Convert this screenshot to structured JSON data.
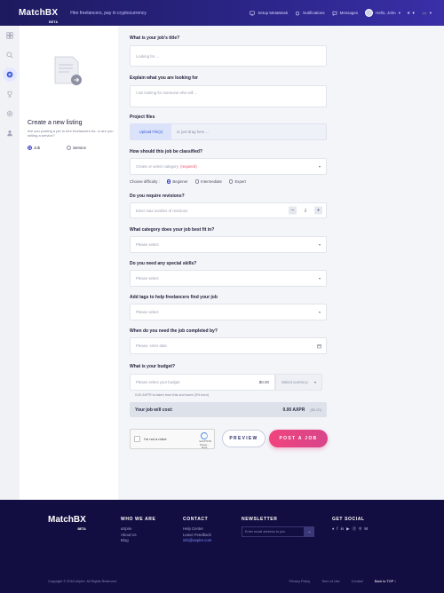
{
  "header": {
    "logo": "MatchBX",
    "logo_badge": "BETA",
    "tagline": "Hire freelancers, pay in cryptocurrency",
    "nav": [
      "Setup MetaMask",
      "Notifications",
      "Messages"
    ],
    "user_greeting": "Hello, John",
    "currency_short": "€"
  },
  "side": {
    "title": "Create a new listing",
    "description": "Are you posting a job to hire freelancers for, or are you selling a service?",
    "options": [
      "Job",
      "Service"
    ],
    "selected": "Job"
  },
  "form": {
    "title_q": "What is your job's title?",
    "title_placeholder": "Looking for ...",
    "explain_q": "Explain what you are looking for",
    "explain_placeholder": "I am looking for someone who will ...",
    "files_q": "Project files",
    "upload_btn": "Upload File(s)",
    "upload_hint": "or just drag here ...",
    "classify_q": "How should this job be classified?",
    "classify_placeholder": "Create or select category",
    "classify_required": "(required)",
    "difficulty_label": "Choose difficulty :",
    "difficulty_options": [
      "Beginner",
      "Intermediate",
      "Expert"
    ],
    "difficulty_selected": "Beginner",
    "revisions_q": "Do you require revisions?",
    "revisions_placeholder": "Enter max number of revisions",
    "revisions_value": "2",
    "revisions_minus": "−",
    "revisions_plus": "+",
    "category_q": "What category does your job best fit in?",
    "category_placeholder": "Please select",
    "skills_q": "Do you need any special skills?",
    "skills_placeholder": "Please select",
    "tags_q": "Add tags to help freelancers find your job",
    "tags_placeholder": "Please select",
    "date_q": "When do you need the job completed by?",
    "date_placeholder": "Please, enter date",
    "budget_q": "What is your budget?",
    "budget_placeholder": "Please select your budget",
    "budget_usd": "$0.00",
    "currency_placeholder": "Select currency",
    "burn_note": "0.00 AXPR is taken from this and burnt (3% burn)",
    "cost_label": "Your job will cost:",
    "cost_amount": "0.00 AXPR",
    "cost_usd": "($0.00)"
  },
  "captcha": {
    "label": "I'm not a robot",
    "brand": "reCAPTCHA",
    "terms": "Privacy - Terms"
  },
  "actions": {
    "preview": "PREVIEW",
    "post": "POST A JOB"
  },
  "footer": {
    "logo": "MatchBX",
    "logo_badge": "BETA",
    "who_title": "WHO WE ARE",
    "who_links": [
      "aXpire",
      "About Us",
      "Blog"
    ],
    "contact_title": "CONTACT",
    "contact_links": [
      "Help Center",
      "Leave Feedback",
      "info@axpire.com"
    ],
    "newsletter_title": "NEWSLETTER",
    "newsletter_placeholder": "Enter email address to join",
    "newsletter_btn": "→",
    "social_title": "GET SOCIAL",
    "social_icons": [
      "♦",
      "f",
      "in",
      "▶",
      "ⓓ",
      "⚲",
      "M"
    ],
    "copyright": "Copyright © 2018 aXpire. All Rights Reserved.",
    "bottom_links": [
      "Privacy Policy",
      "Term of Use",
      "Contact"
    ],
    "back_to_top": "Back to TOP ↑"
  }
}
